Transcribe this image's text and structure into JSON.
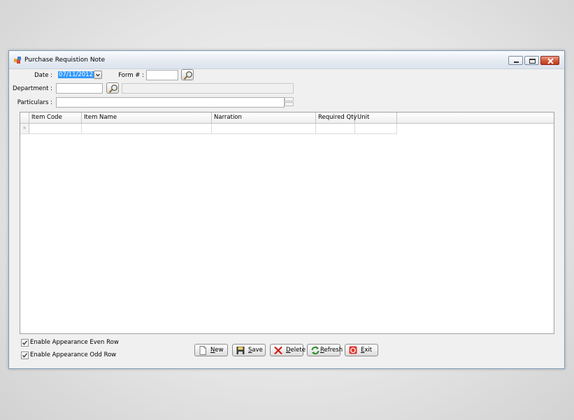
{
  "window": {
    "title": "Purchase Requistion Note"
  },
  "form": {
    "date_label": "Date :",
    "date_value": "07/11/2012",
    "formno_label": "Form # :",
    "formno_value": "",
    "department_label": "Department :",
    "department_value": "",
    "department_name": "",
    "particulars_label": "Particulars :",
    "particulars_value": ""
  },
  "grid": {
    "columns": [
      "Item Code",
      "Item Name",
      "Narration",
      "Required Qty",
      "Unit"
    ],
    "new_row_marker": "*"
  },
  "options": {
    "even_row_label": "Enable Appearance Even Row",
    "even_row_checked": true,
    "odd_row_label": "Enable Appearance Odd Row",
    "odd_row_checked": true
  },
  "buttons": {
    "new": "New",
    "save": "Save",
    "delete": "Delete",
    "refresh": "Refresh",
    "exit": "Exit"
  }
}
